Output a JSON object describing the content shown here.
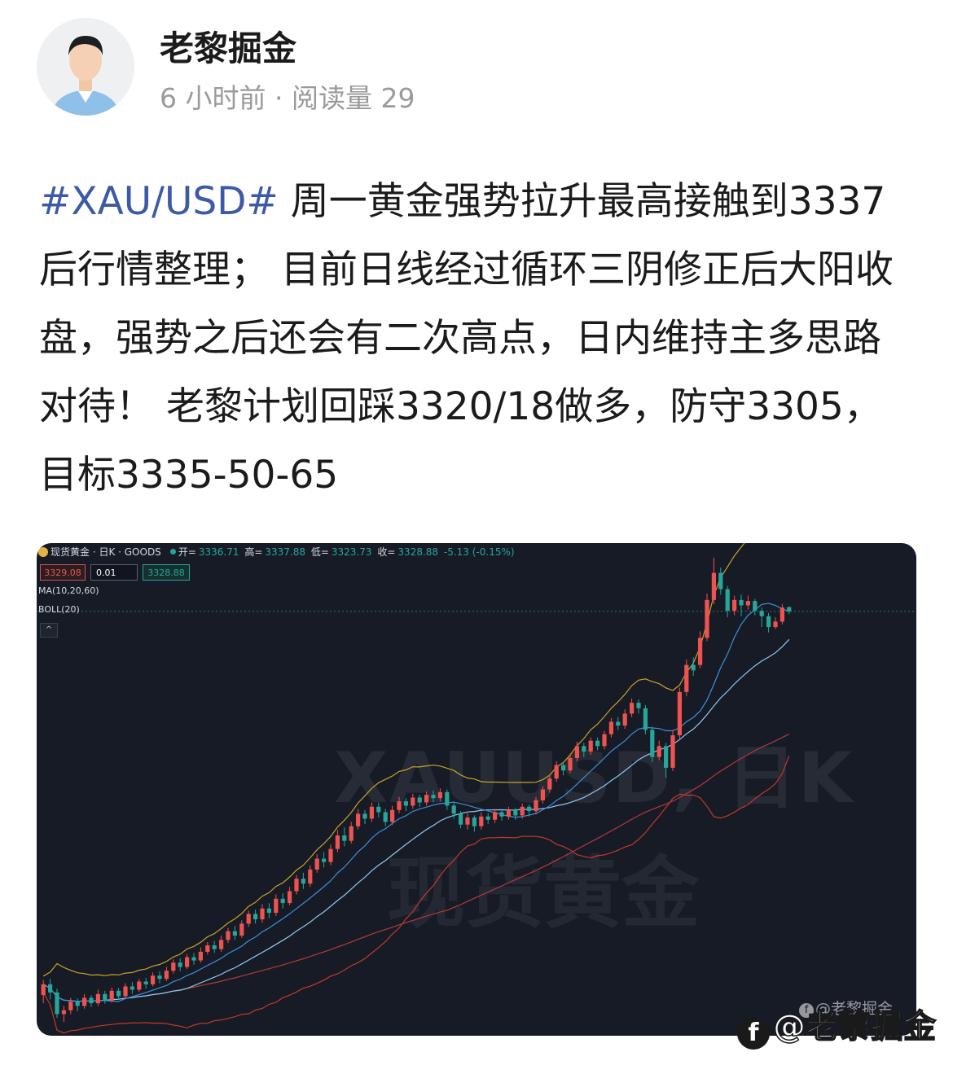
{
  "post": {
    "author": "老黎掘金",
    "time": "6 小时前",
    "separator": "·",
    "reads_label": "阅读量",
    "reads": "29",
    "hashtag": "#XAU/USD#",
    "text": " 周一黄金强势拉升最高接触到3337后行情整理； 目前日线经过循环三阴修正后大阳收盘，强势之后还会有二次高点，日内维持主多思路对待！ 老黎计划回踩3320/18做多，防守3305，目标3335-50-65"
  },
  "chart_header": {
    "symbol": "现货黄金 · 日K · GOODS",
    "open_label": "开=",
    "open": "3336.71",
    "high_label": "高=",
    "high": "3337.88",
    "low_label": "低=",
    "low": "3323.73",
    "close_label": "收=",
    "close": "3328.88",
    "change": "-5.13 (-0.15%)",
    "sell_price": "3329.08",
    "quantity": "0.01",
    "buy_price": "3328.88",
    "ma_label": "MA(10,20,60)",
    "boll_label": "BOLL(20)",
    "collapse_symbol": "^"
  },
  "watermarks": {
    "chart_symbol": "XAUUSD, 日K",
    "chart_name": "现货黄金",
    "small": "@老黎掘金",
    "large": "@老黎掘金",
    "logo_glyph": "f"
  },
  "colors": {
    "up": "#ef5350",
    "down": "#26a69a",
    "boll_upper": "#c9a227",
    "boll_lower": "#c0392b",
    "ma_fast": "#3b8fd9",
    "ma_mid": "#8fc8f0",
    "ma_slow": "#b23a3a",
    "background": "#171b26",
    "hashtag": "#3d5aa6"
  },
  "chart_data": {
    "type": "candlestick",
    "title": "现货黄金 · 日K · GOODS",
    "last_price": 3328.88,
    "ylim": [
      2560,
      3440
    ],
    "candles": [
      [
        2620,
        2640,
        2605,
        2648
      ],
      [
        2640,
        2625,
        2612,
        2650
      ],
      [
        2625,
        2585,
        2578,
        2632
      ],
      [
        2585,
        2592,
        2570,
        2600
      ],
      [
        2592,
        2608,
        2585,
        2615
      ],
      [
        2608,
        2600,
        2590,
        2614
      ],
      [
        2600,
        2615,
        2595,
        2622
      ],
      [
        2615,
        2605,
        2598,
        2620
      ],
      [
        2605,
        2622,
        2600,
        2630
      ],
      [
        2622,
        2610,
        2604,
        2628
      ],
      [
        2610,
        2628,
        2606,
        2634
      ],
      [
        2628,
        2618,
        2612,
        2633
      ],
      [
        2618,
        2636,
        2614,
        2642
      ],
      [
        2636,
        2630,
        2622,
        2644
      ],
      [
        2630,
        2645,
        2626,
        2650
      ],
      [
        2645,
        2640,
        2632,
        2652
      ],
      [
        2640,
        2656,
        2636,
        2662
      ],
      [
        2656,
        2650,
        2642,
        2664
      ],
      [
        2650,
        2665,
        2646,
        2672
      ],
      [
        2665,
        2680,
        2660,
        2686
      ],
      [
        2680,
        2672,
        2664,
        2688
      ],
      [
        2672,
        2690,
        2668,
        2696
      ],
      [
        2690,
        2684,
        2676,
        2698
      ],
      [
        2684,
        2700,
        2680,
        2708
      ],
      [
        2700,
        2712,
        2695,
        2718
      ],
      [
        2712,
        2705,
        2698,
        2720
      ],
      [
        2705,
        2722,
        2700,
        2730
      ],
      [
        2722,
        2738,
        2716,
        2744
      ],
      [
        2738,
        2730,
        2722,
        2748
      ],
      [
        2730,
        2752,
        2726,
        2758
      ],
      [
        2752,
        2770,
        2746,
        2776
      ],
      [
        2770,
        2760,
        2752,
        2778
      ],
      [
        2760,
        2780,
        2754,
        2788
      ],
      [
        2780,
        2772,
        2762,
        2790
      ],
      [
        2772,
        2798,
        2766,
        2806
      ],
      [
        2798,
        2790,
        2780,
        2808
      ],
      [
        2790,
        2812,
        2786,
        2820
      ],
      [
        2812,
        2835,
        2806,
        2842
      ],
      [
        2835,
        2826,
        2816,
        2846
      ],
      [
        2826,
        2852,
        2820,
        2860
      ],
      [
        2852,
        2872,
        2846,
        2880
      ],
      [
        2872,
        2866,
        2856,
        2884
      ],
      [
        2866,
        2890,
        2860,
        2898
      ],
      [
        2890,
        2915,
        2884,
        2925
      ],
      [
        2915,
        2905,
        2895,
        2930
      ],
      [
        2905,
        2932,
        2900,
        2940
      ],
      [
        2932,
        2955,
        2926,
        2964
      ],
      [
        2955,
        2946,
        2936,
        2962
      ],
      [
        2946,
        2968,
        2940,
        2976
      ],
      [
        2968,
        2958,
        2948,
        2976
      ],
      [
        2958,
        2940,
        2932,
        2964
      ],
      [
        2940,
        2962,
        2934,
        2970
      ],
      [
        2962,
        2978,
        2956,
        2986
      ],
      [
        2978,
        2970,
        2960,
        2984
      ],
      [
        2970,
        2985,
        2964,
        2992
      ],
      [
        2985,
        2976,
        2968,
        2990
      ],
      [
        2976,
        2990,
        2970,
        2996
      ],
      [
        2990,
        2984,
        2976,
        2998
      ],
      [
        2984,
        2995,
        2978,
        3002
      ],
      [
        2995,
        2970,
        2962,
        3000
      ],
      [
        2970,
        2955,
        2946,
        2976
      ],
      [
        2955,
        2935,
        2928,
        2960
      ],
      [
        2935,
        2948,
        2926,
        2956
      ],
      [
        2948,
        2932,
        2922,
        2952
      ],
      [
        2932,
        2950,
        2926,
        2958
      ],
      [
        2950,
        2944,
        2936,
        2956
      ],
      [
        2944,
        2958,
        2938,
        2964
      ],
      [
        2958,
        2950,
        2942,
        2962
      ],
      [
        2950,
        2962,
        2944,
        2968
      ],
      [
        2962,
        2952,
        2944,
        2966
      ],
      [
        2952,
        2968,
        2946,
        2974
      ],
      [
        2968,
        2960,
        2950,
        2972
      ],
      [
        2960,
        2980,
        2954,
        2986
      ],
      [
        2980,
        3000,
        2974,
        3006
      ],
      [
        3000,
        3020,
        2994,
        3028
      ],
      [
        3020,
        3045,
        3014,
        3052
      ],
      [
        3045,
        3035,
        3026,
        3050
      ],
      [
        3035,
        3058,
        3030,
        3066
      ],
      [
        3058,
        3080,
        3052,
        3088
      ],
      [
        3080,
        3070,
        3060,
        3086
      ],
      [
        3070,
        3090,
        3064,
        3096
      ],
      [
        3090,
        3080,
        3072,
        3096
      ],
      [
        3080,
        3102,
        3074,
        3108
      ],
      [
        3102,
        3125,
        3096,
        3132
      ],
      [
        3125,
        3118,
        3110,
        3134
      ],
      [
        3118,
        3140,
        3112,
        3148
      ],
      [
        3140,
        3160,
        3134,
        3168
      ],
      [
        3160,
        3150,
        3140,
        3166
      ],
      [
        3150,
        3110,
        3102,
        3156
      ],
      [
        3110,
        3060,
        3050,
        3116
      ],
      [
        3060,
        3080,
        3054,
        3090
      ],
      [
        3080,
        3040,
        3022,
        3086
      ],
      [
        3040,
        3100,
        3034,
        3110
      ],
      [
        3100,
        3180,
        3094,
        3188
      ],
      [
        3180,
        3230,
        3172,
        3240
      ],
      [
        3230,
        3220,
        3210,
        3244
      ],
      [
        3230,
        3280,
        3224,
        3292
      ],
      [
        3280,
        3350,
        3274,
        3362
      ],
      [
        3350,
        3400,
        3342,
        3428
      ],
      [
        3400,
        3370,
        3360,
        3410
      ],
      [
        3370,
        3330,
        3318,
        3376
      ],
      [
        3330,
        3350,
        3322,
        3358
      ],
      [
        3350,
        3340,
        3320,
        3360
      ],
      [
        3340,
        3348,
        3332,
        3358
      ],
      [
        3348,
        3330,
        3322,
        3352
      ],
      [
        3330,
        3320,
        3300,
        3336
      ],
      [
        3320,
        3300,
        3290,
        3326
      ],
      [
        3300,
        3310,
        3296,
        3318
      ],
      [
        3310,
        3336,
        3305,
        3342
      ],
      [
        3336.71,
        3328.88,
        3323.73,
        3337.88
      ]
    ]
  }
}
